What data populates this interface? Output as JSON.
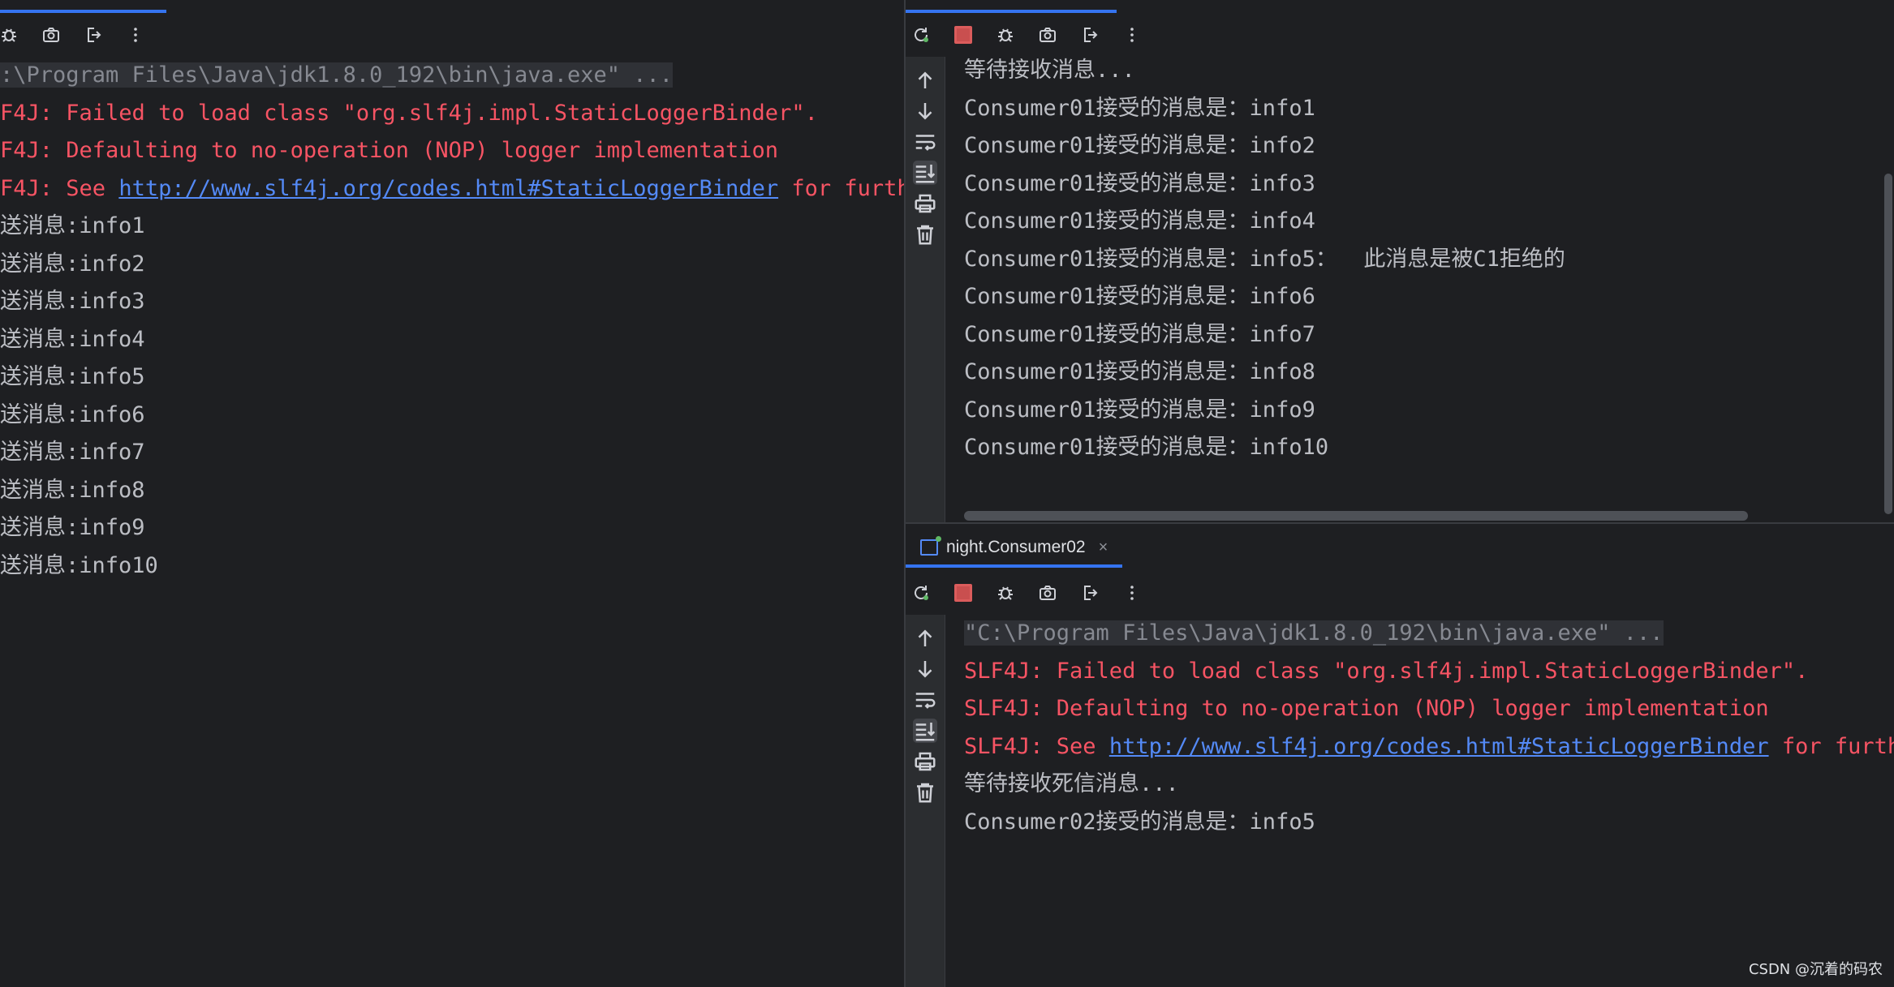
{
  "left": {
    "toolbar_icons": [
      "debug-icon",
      "camera-icon",
      "exit-icon",
      "more-icon"
    ],
    "lines": [
      {
        "text": ":\\Program Files\\Java\\jdk1.8.0_192\\bin\\java.exe\" ...",
        "style": "gray cmd-bg"
      },
      {
        "text": "F4J: Failed to load class \"org.slf4j.impl.StaticLoggerBinder\".",
        "style": "red"
      },
      {
        "text": "F4J: Defaulting to no-operation (NOP) logger implementation",
        "style": "red"
      },
      {
        "text": "F4J: See ",
        "style": "red",
        "link": "http://www.slf4j.org/codes.html#StaticLoggerBinder",
        "after": " for furthe"
      },
      {
        "text": "送消息:info1",
        "style": "norm"
      },
      {
        "text": "送消息:info2",
        "style": "norm"
      },
      {
        "text": "送消息:info3",
        "style": "norm"
      },
      {
        "text": "送消息:info4",
        "style": "norm"
      },
      {
        "text": "送消息:info5",
        "style": "norm"
      },
      {
        "text": "送消息:info6",
        "style": "norm"
      },
      {
        "text": "送消息:info7",
        "style": "norm"
      },
      {
        "text": "送消息:info8",
        "style": "norm"
      },
      {
        "text": "送消息:info9",
        "style": "norm"
      },
      {
        "text": "送消息:info10",
        "style": "norm"
      }
    ]
  },
  "right_top": {
    "toolbar_icons": [
      "rerun-icon",
      "stop-icon",
      "debug-icon",
      "camera-icon",
      "exit-icon",
      "more-icon"
    ],
    "lines": [
      {
        "text": "等待接收消息...",
        "style": "norm"
      },
      {
        "text": "Consumer01接受的消息是：info1",
        "style": "norm"
      },
      {
        "text": "Consumer01接受的消息是：info2",
        "style": "norm"
      },
      {
        "text": "Consumer01接受的消息是：info3",
        "style": "norm"
      },
      {
        "text": "Consumer01接受的消息是：info4",
        "style": "norm"
      },
      {
        "text": "Consumer01接受的消息是：info5：  此消息是被C1拒绝的",
        "style": "norm"
      },
      {
        "text": "Consumer01接受的消息是：info6",
        "style": "norm"
      },
      {
        "text": "Consumer01接受的消息是：info7",
        "style": "norm"
      },
      {
        "text": "Consumer01接受的消息是：info8",
        "style": "norm"
      },
      {
        "text": "Consumer01接受的消息是：info9",
        "style": "norm"
      },
      {
        "text": "Consumer01接受的消息是：info10",
        "style": "norm"
      }
    ]
  },
  "right_bottom": {
    "tab_label": "night.Consumer02",
    "tab_close": "×",
    "toolbar_icons": [
      "rerun-icon",
      "stop-icon",
      "debug-icon",
      "camera-icon",
      "exit-icon",
      "more-icon"
    ],
    "lines": [
      {
        "text": "\"C:\\Program Files\\Java\\jdk1.8.0_192\\bin\\java.exe\" ...",
        "style": "gray cmd-bg"
      },
      {
        "text": "SLF4J: Failed to load class \"org.slf4j.impl.StaticLoggerBinder\".",
        "style": "red"
      },
      {
        "text": "SLF4J: Defaulting to no-operation (NOP) logger implementation",
        "style": "red"
      },
      {
        "text": "SLF4J: See ",
        "style": "red",
        "link": "http://www.slf4j.org/codes.html#StaticLoggerBinder",
        "after": " for furthe"
      },
      {
        "text": "等待接收死信消息...",
        "style": "norm"
      },
      {
        "text": "Consumer02接受的消息是：info5",
        "style": "norm"
      }
    ]
  },
  "side_icons": [
    "arrow-up-icon",
    "arrow-down-icon",
    "soft-wrap-icon",
    "scroll-to-end-icon",
    "print-icon",
    "trash-icon"
  ],
  "watermark": "CSDN @沉着的码农",
  "colors": {
    "background": "#1e1f22",
    "error": "#f75464",
    "link": "#548af7",
    "accent": "#3574f0"
  }
}
